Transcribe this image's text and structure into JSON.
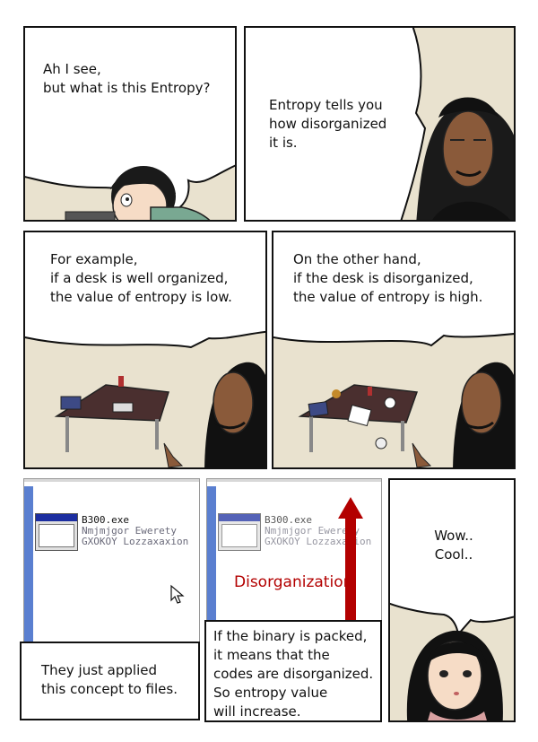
{
  "panel1": {
    "lines": [
      "Ah I see,",
      "but what is this Entropy?"
    ]
  },
  "panel2": {
    "lines": [
      "Entropy tells you",
      "how disorganized",
      "it is."
    ]
  },
  "panel3": {
    "lines": [
      "For example,",
      "if a desk is well organized,",
      "the value of entropy is low."
    ]
  },
  "panel4": {
    "lines": [
      "On the other hand,",
      "if the desk is disorganized,",
      "the value of entropy is high."
    ]
  },
  "panel5": {
    "file_name": "B300.exe",
    "file_line2": "Nmjmjgor Ewerety",
    "file_line3": "GXOKOY Lozzaxaxion",
    "caption_lines": [
      "They just applied",
      "this concept to files."
    ]
  },
  "panel6": {
    "file_name": "B300.exe",
    "file_line2": "Nmjmjgor Ewerety",
    "file_line3": "GXOKOY Lozzaxaxion",
    "arrow_label": "Disorganization",
    "caption_lines": [
      "If the binary is packed,",
      "it means that the",
      "codes are disorganized.",
      "So entropy value",
      "will increase."
    ],
    "colors": {
      "arrow": "#b30000"
    }
  },
  "panel7": {
    "lines": [
      "Wow..",
      "Cool.."
    ]
  }
}
